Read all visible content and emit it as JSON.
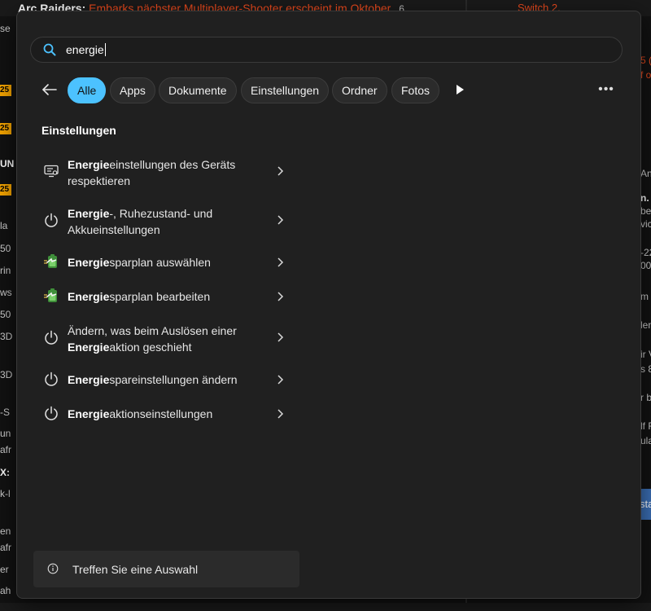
{
  "background": {
    "headline_title": "Arc Raiders:",
    "headline_text": "Embarks nächster Multiplayer-Shooter erscheint im Oktober",
    "headline_count": "6",
    "right_top": "Switch 2.",
    "left_fragments": [
      "se",
      "25",
      "25",
      "UN",
      "25",
      "la",
      "50",
      "rin",
      "ws",
      "50",
      "3D",
      "3D",
      "-S",
      "un",
      "afr",
      "X:",
      "k-l",
      "en",
      "afr",
      "er",
      "ah"
    ],
    "right_fragments": [
      "5 (",
      "f o",
      "An",
      "n. I",
      "be",
      "vic",
      "-22",
      "00",
      "m",
      "len",
      "ir V",
      "s 8",
      "r b",
      "lf R",
      "ula",
      "sta"
    ]
  },
  "search": {
    "query": "energie"
  },
  "filters": {
    "back_label": "Zurück",
    "chips": [
      "Alle",
      "Apps",
      "Dokumente",
      "Einstellungen",
      "Ordner",
      "Fotos"
    ],
    "active": "Alle"
  },
  "section_title": "Einstellungen",
  "results": [
    {
      "bold": "Energie",
      "rest": "einstellungen des Geräts respektieren",
      "prefix": "",
      "icon": "device-settings-icon"
    },
    {
      "bold": "Energie",
      "rest": "-, Ruhezustand- und Akkueinstellungen",
      "prefix": "",
      "icon": "power-icon"
    },
    {
      "bold": "Energie",
      "rest": "sparplan auswählen",
      "prefix": "",
      "icon": "battery-plan-icon"
    },
    {
      "bold": "Energie",
      "rest": "sparplan bearbeiten",
      "prefix": "",
      "icon": "battery-plan-icon"
    },
    {
      "bold": "Energie",
      "rest": "aktion geschieht",
      "prefix": "Ändern, was beim Auslösen einer",
      "icon": "power-icon"
    },
    {
      "bold": "Energie",
      "rest": "spareinstellungen ändern",
      "prefix": "",
      "icon": "power-icon"
    },
    {
      "bold": "Energie",
      "rest": "aktionseinstellungen",
      "prefix": "",
      "icon": "power-icon"
    }
  ],
  "status": {
    "text": "Treffen Sie eine Auswahl"
  },
  "colors": {
    "accent": "#4cc2ff",
    "flyout_bg": "#202020",
    "headline_orange": "#e8491d"
  }
}
